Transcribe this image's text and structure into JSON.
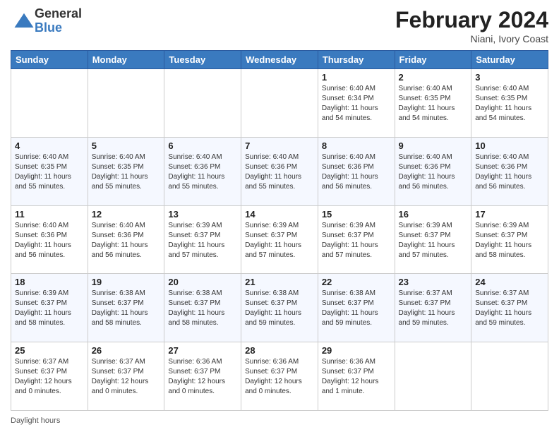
{
  "header": {
    "logo": {
      "general": "General",
      "blue": "Blue"
    },
    "title": "February 2024",
    "location": "Niani, Ivory Coast"
  },
  "days_of_week": [
    "Sunday",
    "Monday",
    "Tuesday",
    "Wednesday",
    "Thursday",
    "Friday",
    "Saturday"
  ],
  "weeks": [
    [
      {
        "day": "",
        "info": ""
      },
      {
        "day": "",
        "info": ""
      },
      {
        "day": "",
        "info": ""
      },
      {
        "day": "",
        "info": ""
      },
      {
        "day": "1",
        "info": "Sunrise: 6:40 AM\nSunset: 6:34 PM\nDaylight: 11 hours\nand 54 minutes."
      },
      {
        "day": "2",
        "info": "Sunrise: 6:40 AM\nSunset: 6:35 PM\nDaylight: 11 hours\nand 54 minutes."
      },
      {
        "day": "3",
        "info": "Sunrise: 6:40 AM\nSunset: 6:35 PM\nDaylight: 11 hours\nand 54 minutes."
      }
    ],
    [
      {
        "day": "4",
        "info": "Sunrise: 6:40 AM\nSunset: 6:35 PM\nDaylight: 11 hours\nand 55 minutes."
      },
      {
        "day": "5",
        "info": "Sunrise: 6:40 AM\nSunset: 6:35 PM\nDaylight: 11 hours\nand 55 minutes."
      },
      {
        "day": "6",
        "info": "Sunrise: 6:40 AM\nSunset: 6:36 PM\nDaylight: 11 hours\nand 55 minutes."
      },
      {
        "day": "7",
        "info": "Sunrise: 6:40 AM\nSunset: 6:36 PM\nDaylight: 11 hours\nand 55 minutes."
      },
      {
        "day": "8",
        "info": "Sunrise: 6:40 AM\nSunset: 6:36 PM\nDaylight: 11 hours\nand 56 minutes."
      },
      {
        "day": "9",
        "info": "Sunrise: 6:40 AM\nSunset: 6:36 PM\nDaylight: 11 hours\nand 56 minutes."
      },
      {
        "day": "10",
        "info": "Sunrise: 6:40 AM\nSunset: 6:36 PM\nDaylight: 11 hours\nand 56 minutes."
      }
    ],
    [
      {
        "day": "11",
        "info": "Sunrise: 6:40 AM\nSunset: 6:36 PM\nDaylight: 11 hours\nand 56 minutes."
      },
      {
        "day": "12",
        "info": "Sunrise: 6:40 AM\nSunset: 6:36 PM\nDaylight: 11 hours\nand 56 minutes."
      },
      {
        "day": "13",
        "info": "Sunrise: 6:39 AM\nSunset: 6:37 PM\nDaylight: 11 hours\nand 57 minutes."
      },
      {
        "day": "14",
        "info": "Sunrise: 6:39 AM\nSunset: 6:37 PM\nDaylight: 11 hours\nand 57 minutes."
      },
      {
        "day": "15",
        "info": "Sunrise: 6:39 AM\nSunset: 6:37 PM\nDaylight: 11 hours\nand 57 minutes."
      },
      {
        "day": "16",
        "info": "Sunrise: 6:39 AM\nSunset: 6:37 PM\nDaylight: 11 hours\nand 57 minutes."
      },
      {
        "day": "17",
        "info": "Sunrise: 6:39 AM\nSunset: 6:37 PM\nDaylight: 11 hours\nand 58 minutes."
      }
    ],
    [
      {
        "day": "18",
        "info": "Sunrise: 6:39 AM\nSunset: 6:37 PM\nDaylight: 11 hours\nand 58 minutes."
      },
      {
        "day": "19",
        "info": "Sunrise: 6:38 AM\nSunset: 6:37 PM\nDaylight: 11 hours\nand 58 minutes."
      },
      {
        "day": "20",
        "info": "Sunrise: 6:38 AM\nSunset: 6:37 PM\nDaylight: 11 hours\nand 58 minutes."
      },
      {
        "day": "21",
        "info": "Sunrise: 6:38 AM\nSunset: 6:37 PM\nDaylight: 11 hours\nand 59 minutes."
      },
      {
        "day": "22",
        "info": "Sunrise: 6:38 AM\nSunset: 6:37 PM\nDaylight: 11 hours\nand 59 minutes."
      },
      {
        "day": "23",
        "info": "Sunrise: 6:37 AM\nSunset: 6:37 PM\nDaylight: 11 hours\nand 59 minutes."
      },
      {
        "day": "24",
        "info": "Sunrise: 6:37 AM\nSunset: 6:37 PM\nDaylight: 11 hours\nand 59 minutes."
      }
    ],
    [
      {
        "day": "25",
        "info": "Sunrise: 6:37 AM\nSunset: 6:37 PM\nDaylight: 12 hours\nand 0 minutes."
      },
      {
        "day": "26",
        "info": "Sunrise: 6:37 AM\nSunset: 6:37 PM\nDaylight: 12 hours\nand 0 minutes."
      },
      {
        "day": "27",
        "info": "Sunrise: 6:36 AM\nSunset: 6:37 PM\nDaylight: 12 hours\nand 0 minutes."
      },
      {
        "day": "28",
        "info": "Sunrise: 6:36 AM\nSunset: 6:37 PM\nDaylight: 12 hours\nand 0 minutes."
      },
      {
        "day": "29",
        "info": "Sunrise: 6:36 AM\nSunset: 6:37 PM\nDaylight: 12 hours\nand 1 minute."
      },
      {
        "day": "",
        "info": ""
      },
      {
        "day": "",
        "info": ""
      }
    ]
  ],
  "footer": {
    "daylight_label": "Daylight hours"
  },
  "colors": {
    "header_bg": "#3a7abf",
    "header_text": "#ffffff",
    "alt_row": "#f5f8ff"
  }
}
